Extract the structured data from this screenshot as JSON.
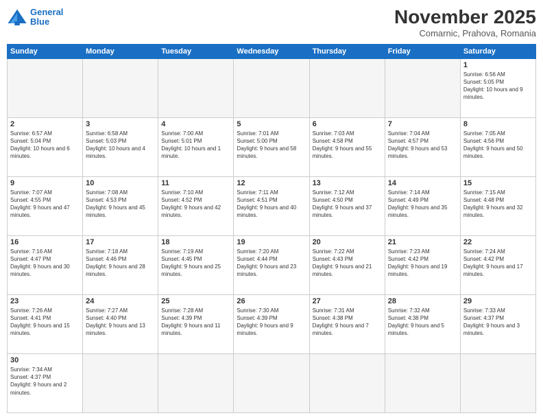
{
  "logo": {
    "line1": "General",
    "line2": "Blue"
  },
  "title": "November 2025",
  "subtitle": "Comarnic, Prahova, Romania",
  "weekdays": [
    "Sunday",
    "Monday",
    "Tuesday",
    "Wednesday",
    "Thursday",
    "Friday",
    "Saturday"
  ],
  "days": {
    "d1": {
      "num": "1",
      "rise": "6:56 AM",
      "set": "5:05 PM",
      "daylight": "10 hours and 9 minutes."
    },
    "d2": {
      "num": "2",
      "rise": "6:57 AM",
      "set": "5:04 PM",
      "daylight": "10 hours and 6 minutes."
    },
    "d3": {
      "num": "3",
      "rise": "6:58 AM",
      "set": "5:03 PM",
      "daylight": "10 hours and 4 minutes."
    },
    "d4": {
      "num": "4",
      "rise": "7:00 AM",
      "set": "5:01 PM",
      "daylight": "10 hours and 1 minute."
    },
    "d5": {
      "num": "5",
      "rise": "7:01 AM",
      "set": "5:00 PM",
      "daylight": "9 hours and 58 minutes."
    },
    "d6": {
      "num": "6",
      "rise": "7:03 AM",
      "set": "4:58 PM",
      "daylight": "9 hours and 55 minutes."
    },
    "d7": {
      "num": "7",
      "rise": "7:04 AM",
      "set": "4:57 PM",
      "daylight": "9 hours and 53 minutes."
    },
    "d8": {
      "num": "8",
      "rise": "7:05 AM",
      "set": "4:56 PM",
      "daylight": "9 hours and 50 minutes."
    },
    "d9": {
      "num": "9",
      "rise": "7:07 AM",
      "set": "4:55 PM",
      "daylight": "9 hours and 47 minutes."
    },
    "d10": {
      "num": "10",
      "rise": "7:08 AM",
      "set": "4:53 PM",
      "daylight": "9 hours and 45 minutes."
    },
    "d11": {
      "num": "11",
      "rise": "7:10 AM",
      "set": "4:52 PM",
      "daylight": "9 hours and 42 minutes."
    },
    "d12": {
      "num": "12",
      "rise": "7:11 AM",
      "set": "4:51 PM",
      "daylight": "9 hours and 40 minutes."
    },
    "d13": {
      "num": "13",
      "rise": "7:12 AM",
      "set": "4:50 PM",
      "daylight": "9 hours and 37 minutes."
    },
    "d14": {
      "num": "14",
      "rise": "7:14 AM",
      "set": "4:49 PM",
      "daylight": "9 hours and 35 minutes."
    },
    "d15": {
      "num": "15",
      "rise": "7:15 AM",
      "set": "4:48 PM",
      "daylight": "9 hours and 32 minutes."
    },
    "d16": {
      "num": "16",
      "rise": "7:16 AM",
      "set": "4:47 PM",
      "daylight": "9 hours and 30 minutes."
    },
    "d17": {
      "num": "17",
      "rise": "7:18 AM",
      "set": "4:46 PM",
      "daylight": "9 hours and 28 minutes."
    },
    "d18": {
      "num": "18",
      "rise": "7:19 AM",
      "set": "4:45 PM",
      "daylight": "9 hours and 25 minutes."
    },
    "d19": {
      "num": "19",
      "rise": "7:20 AM",
      "set": "4:44 PM",
      "daylight": "9 hours and 23 minutes."
    },
    "d20": {
      "num": "20",
      "rise": "7:22 AM",
      "set": "4:43 PM",
      "daylight": "9 hours and 21 minutes."
    },
    "d21": {
      "num": "21",
      "rise": "7:23 AM",
      "set": "4:42 PM",
      "daylight": "9 hours and 19 minutes."
    },
    "d22": {
      "num": "22",
      "rise": "7:24 AM",
      "set": "4:42 PM",
      "daylight": "9 hours and 17 minutes."
    },
    "d23": {
      "num": "23",
      "rise": "7:26 AM",
      "set": "4:41 PM",
      "daylight": "9 hours and 15 minutes."
    },
    "d24": {
      "num": "24",
      "rise": "7:27 AM",
      "set": "4:40 PM",
      "daylight": "9 hours and 13 minutes."
    },
    "d25": {
      "num": "25",
      "rise": "7:28 AM",
      "set": "4:39 PM",
      "daylight": "9 hours and 11 minutes."
    },
    "d26": {
      "num": "26",
      "rise": "7:30 AM",
      "set": "4:39 PM",
      "daylight": "9 hours and 9 minutes."
    },
    "d27": {
      "num": "27",
      "rise": "7:31 AM",
      "set": "4:38 PM",
      "daylight": "9 hours and 7 minutes."
    },
    "d28": {
      "num": "28",
      "rise": "7:32 AM",
      "set": "4:38 PM",
      "daylight": "9 hours and 5 minutes."
    },
    "d29": {
      "num": "29",
      "rise": "7:33 AM",
      "set": "4:37 PM",
      "daylight": "9 hours and 3 minutes."
    },
    "d30": {
      "num": "30",
      "rise": "7:34 AM",
      "set": "4:37 PM",
      "daylight": "9 hours and 2 minutes."
    }
  }
}
